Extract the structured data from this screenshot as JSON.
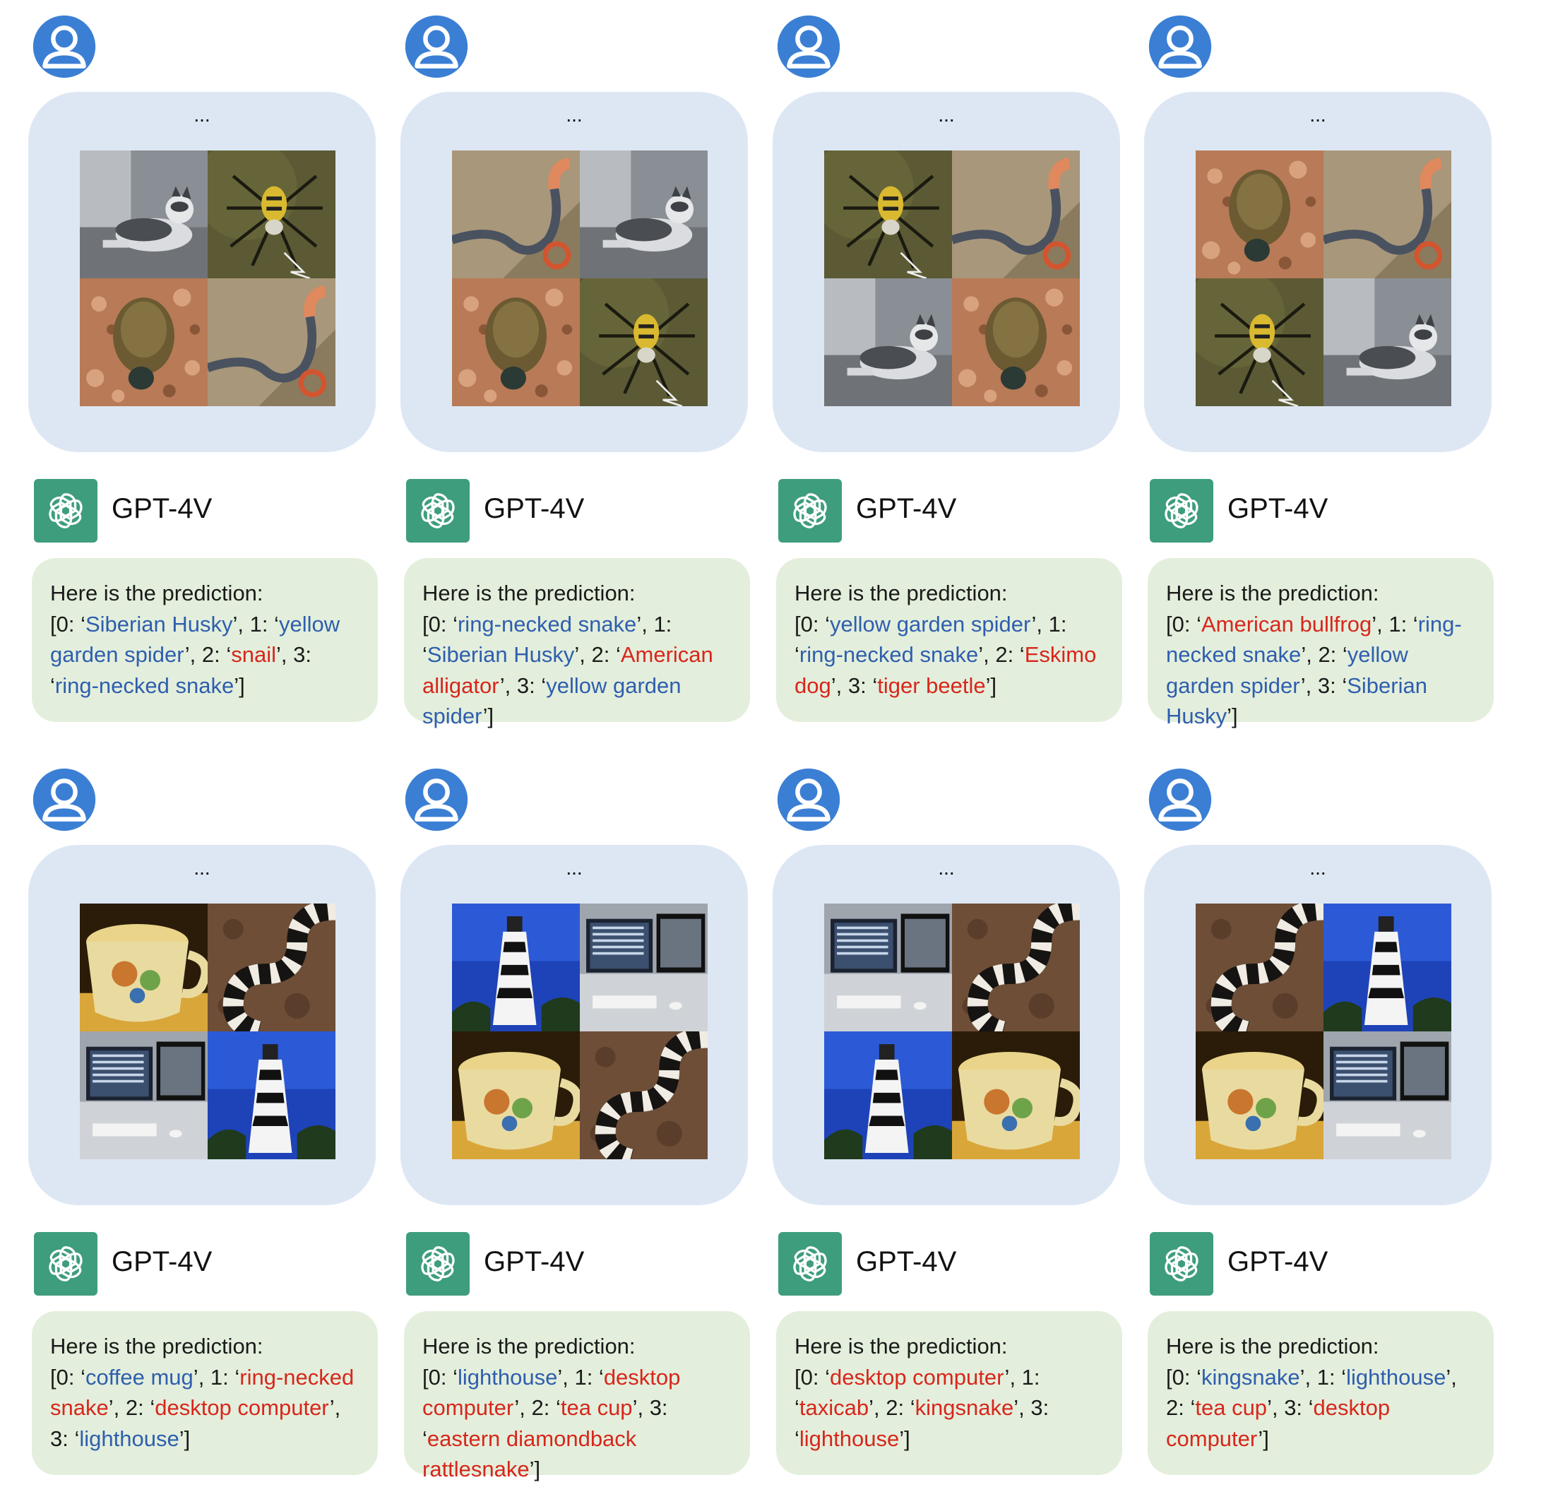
{
  "colors": {
    "correct": "#2f5eae",
    "incorrect": "#d8261c",
    "image_bubble": "#dde7f4",
    "reply_bubble": "#e3efdc",
    "gpt_logo": "#3e9d7c",
    "user_icon": "#3b7fd4"
  },
  "cells": [
    {
      "ellipsis": "...",
      "grid": [
        "husky",
        "spider",
        "bullfrog",
        "snake"
      ],
      "model_name": "GPT-4V",
      "reply": {
        "head": "Here is the prediction:",
        "items": [
          {
            "idx": "0",
            "label": "Siberian Husky",
            "status": "correct"
          },
          {
            "idx": "1",
            "label": "yellow garden spider",
            "status": "correct"
          },
          {
            "idx": "2",
            "label": "snail",
            "status": "incorrect"
          },
          {
            "idx": "3",
            "label": "ring-necked snake",
            "status": "correct"
          }
        ]
      }
    },
    {
      "ellipsis": "...",
      "grid": [
        "snake",
        "husky",
        "bullfrog",
        "spider"
      ],
      "model_name": "GPT-4V",
      "reply": {
        "head": "Here is the prediction:",
        "items": [
          {
            "idx": "0",
            "label": "ring-necked snake",
            "status": "correct"
          },
          {
            "idx": "1",
            "label": "Siberian Husky",
            "status": "correct"
          },
          {
            "idx": "2",
            "label": "American alligator",
            "status": "incorrect"
          },
          {
            "idx": "3",
            "label": "yellow garden spider",
            "status": "correct"
          }
        ]
      }
    },
    {
      "ellipsis": "...",
      "grid": [
        "spider",
        "snake",
        "husky",
        "bullfrog"
      ],
      "model_name": "GPT-4V",
      "reply": {
        "head": "Here is the prediction:",
        "items": [
          {
            "idx": "0",
            "label": "yellow garden spider",
            "status": "correct"
          },
          {
            "idx": "1",
            "label": "ring-necked snake",
            "status": "correct"
          },
          {
            "idx": "2",
            "label": "Eskimo dog",
            "status": "incorrect"
          },
          {
            "idx": "3",
            "label": "tiger beetle",
            "status": "incorrect"
          }
        ]
      }
    },
    {
      "ellipsis": "...",
      "grid": [
        "bullfrog",
        "snake",
        "spider",
        "husky"
      ],
      "model_name": "GPT-4V",
      "reply": {
        "head": "Here is the prediction:",
        "items": [
          {
            "idx": "0",
            "label": "American bullfrog",
            "status": "incorrect"
          },
          {
            "idx": "1",
            "label": "ring-necked snake",
            "status": "correct"
          },
          {
            "idx": "2",
            "label": "yellow garden spider",
            "status": "correct"
          },
          {
            "idx": "3",
            "label": "Siberian Husky",
            "status": "correct"
          }
        ]
      }
    },
    {
      "ellipsis": "...",
      "grid": [
        "mug",
        "kingsnake",
        "computer",
        "lighthouse"
      ],
      "model_name": "GPT-4V",
      "reply": {
        "head": "Here is the prediction:",
        "items": [
          {
            "idx": "0",
            "label": "coffee mug",
            "status": "correct"
          },
          {
            "idx": "1",
            "label": "ring-necked snake",
            "status": "incorrect"
          },
          {
            "idx": "2",
            "label": "desktop computer",
            "status": "incorrect"
          },
          {
            "idx": "3",
            "label": "lighthouse",
            "status": "correct"
          }
        ]
      }
    },
    {
      "ellipsis": "...",
      "grid": [
        "lighthouse",
        "computer",
        "mug",
        "kingsnake"
      ],
      "model_name": "GPT-4V",
      "reply": {
        "head": "Here is the prediction:",
        "items": [
          {
            "idx": "0",
            "label": "lighthouse",
            "status": "correct"
          },
          {
            "idx": "1",
            "label": "desktop computer",
            "status": "incorrect"
          },
          {
            "idx": "2",
            "label": "tea cup",
            "status": "incorrect"
          },
          {
            "idx": "3",
            "label": "eastern diamondback rattlesnake",
            "status": "incorrect"
          }
        ]
      }
    },
    {
      "ellipsis": "...",
      "grid": [
        "computer",
        "kingsnake",
        "lighthouse",
        "mug"
      ],
      "model_name": "GPT-4V",
      "reply": {
        "head": "Here is the prediction:",
        "items": [
          {
            "idx": "0",
            "label": "desktop computer",
            "status": "incorrect"
          },
          {
            "idx": "1",
            "label": "taxicab",
            "status": "incorrect"
          },
          {
            "idx": "2",
            "label": "kingsnake",
            "status": "incorrect"
          },
          {
            "idx": "3",
            "label": "lighthouse",
            "status": "incorrect"
          }
        ]
      }
    },
    {
      "ellipsis": "...",
      "grid": [
        "kingsnake",
        "lighthouse",
        "mug",
        "computer"
      ],
      "model_name": "GPT-4V",
      "reply": {
        "head": "Here is the prediction:",
        "items": [
          {
            "idx": "0",
            "label": "kingsnake",
            "status": "correct"
          },
          {
            "idx": "1",
            "label": "lighthouse",
            "status": "correct"
          },
          {
            "idx": "2",
            "label": "tea cup",
            "status": "incorrect"
          },
          {
            "idx": "3",
            "label": "desktop computer",
            "status": "incorrect"
          }
        ]
      }
    }
  ]
}
